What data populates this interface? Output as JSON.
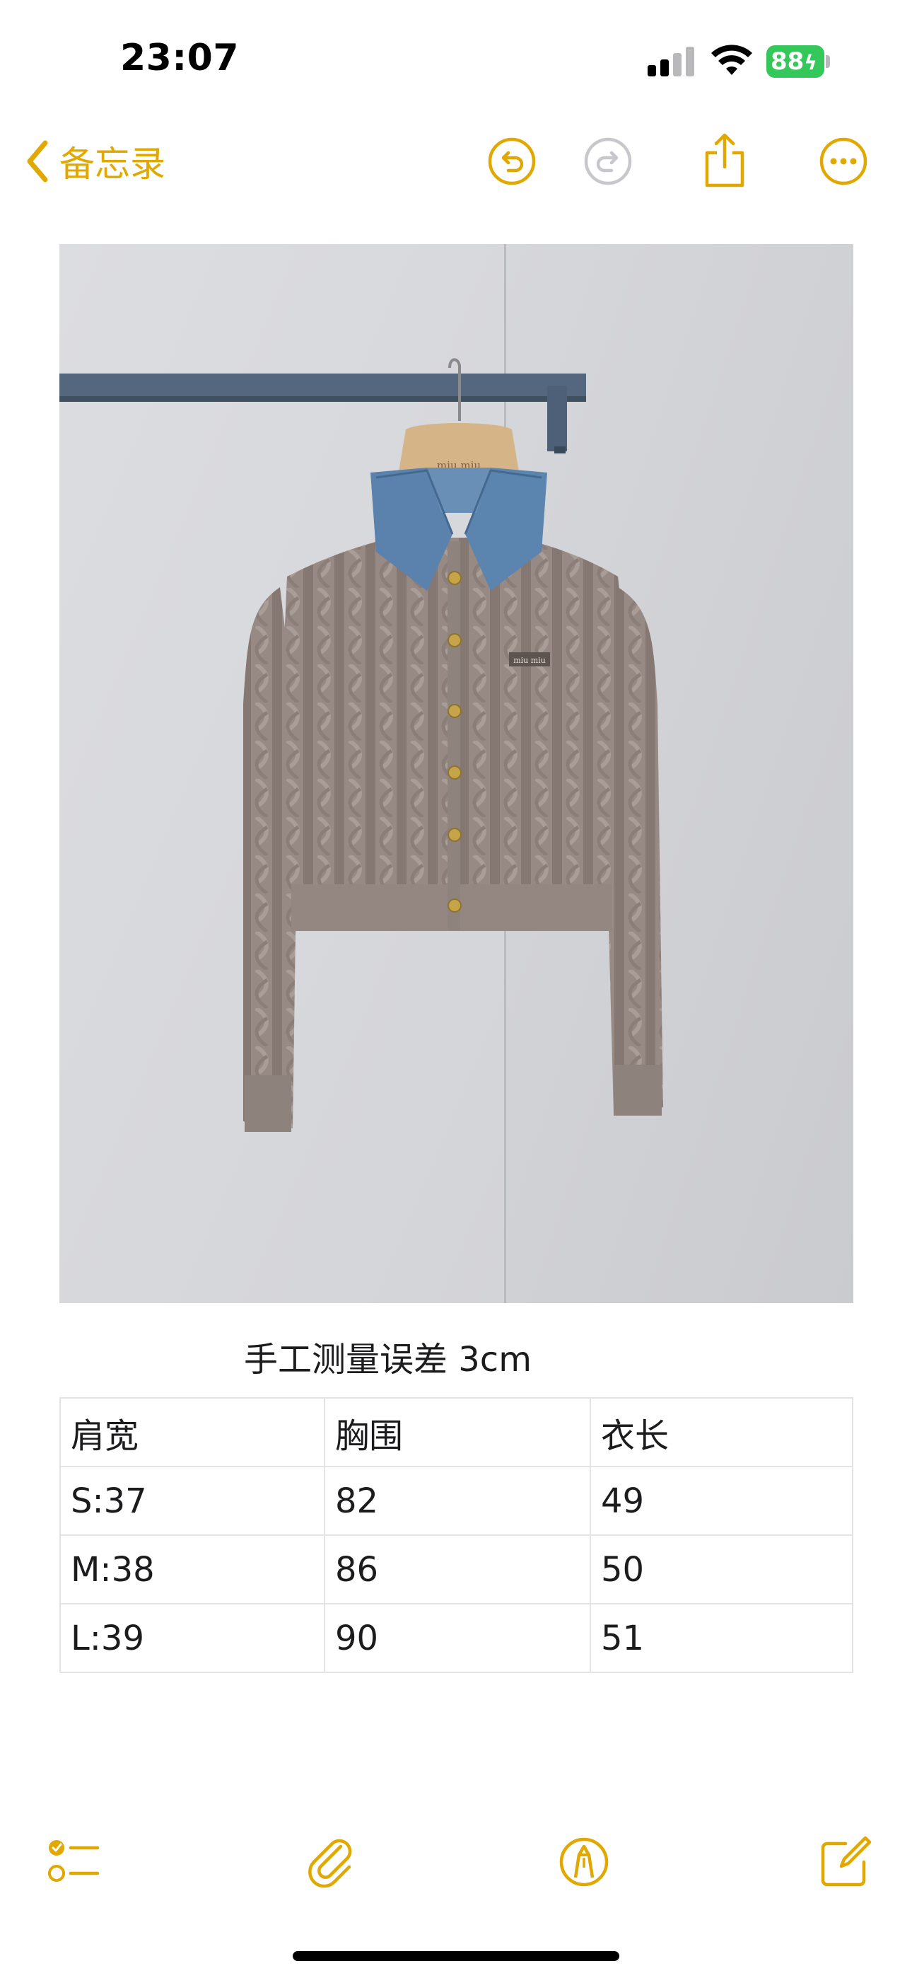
{
  "status_bar": {
    "time": "23:07",
    "battery_percent": "88",
    "battery_charging": true,
    "icons": [
      "signal-icon",
      "wifi-icon",
      "battery-icon"
    ]
  },
  "nav": {
    "back_label": "备忘录",
    "icons": [
      "chevron-left-icon",
      "undo-icon",
      "redo-icon",
      "share-icon",
      "more-icon"
    ],
    "redo_enabled": false
  },
  "note": {
    "photo": {
      "subject": "cardigan-photo",
      "hanger_logo": "miu miu",
      "badge_text": "miu miu"
    },
    "caption": "手工测量误差 3cm",
    "table": {
      "headers": [
        "肩宽",
        "胸围",
        "衣长"
      ],
      "rows": [
        [
          "S:37",
          "82",
          "49"
        ],
        [
          "M:38",
          "86",
          "50"
        ],
        [
          "L:39",
          "90",
          "51"
        ]
      ]
    }
  },
  "toolbar": {
    "icons": [
      "checklist-icon",
      "attachment-icon",
      "markup-icon",
      "compose-icon"
    ]
  },
  "colors": {
    "accent": "#e0a800",
    "battery": "#34c759",
    "disabled": "#c7c7cc",
    "table_border": "#e3e3e6"
  }
}
